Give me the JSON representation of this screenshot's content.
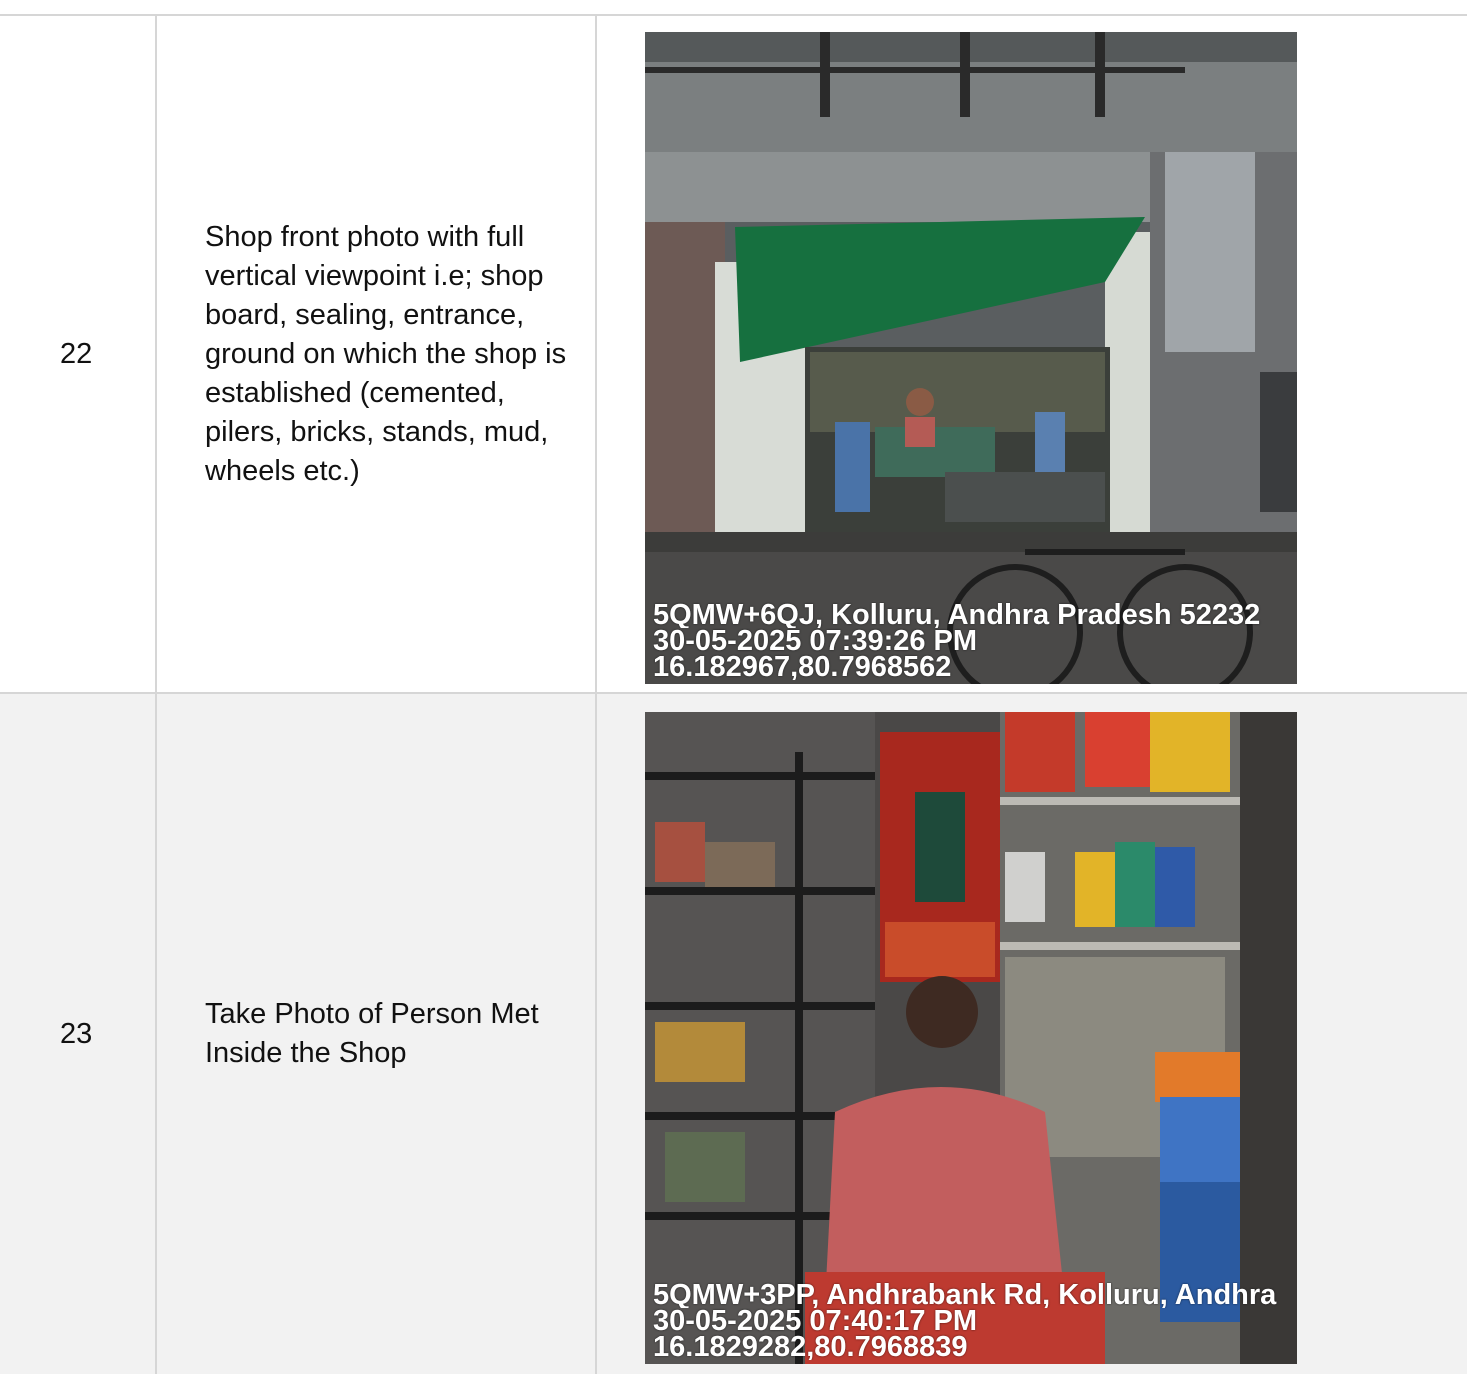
{
  "rows": [
    {
      "number": "22",
      "description": "Shop front photo with full vertical viewpoint i.e; shop board, sealing, entrance, ground on which the shop is established (cemented, pilers, bricks, stands, mud, wheels etc.)",
      "photo": {
        "address": "5QMW+6QJ, Kolluru, Andhra Pradesh 52232",
        "datetime": "30-05-2025 07:39:26 PM",
        "coords": "16.182967,80.7968562"
      }
    },
    {
      "number": "23",
      "description": "Take Photo of Person Met Inside the Shop",
      "photo": {
        "address": "5QMW+3PP, Andhrabank Rd, Kolluru, Andhra",
        "datetime": "30-05-2025 07:40:17 PM",
        "coords": "16.1829282,80.7968839"
      }
    }
  ]
}
